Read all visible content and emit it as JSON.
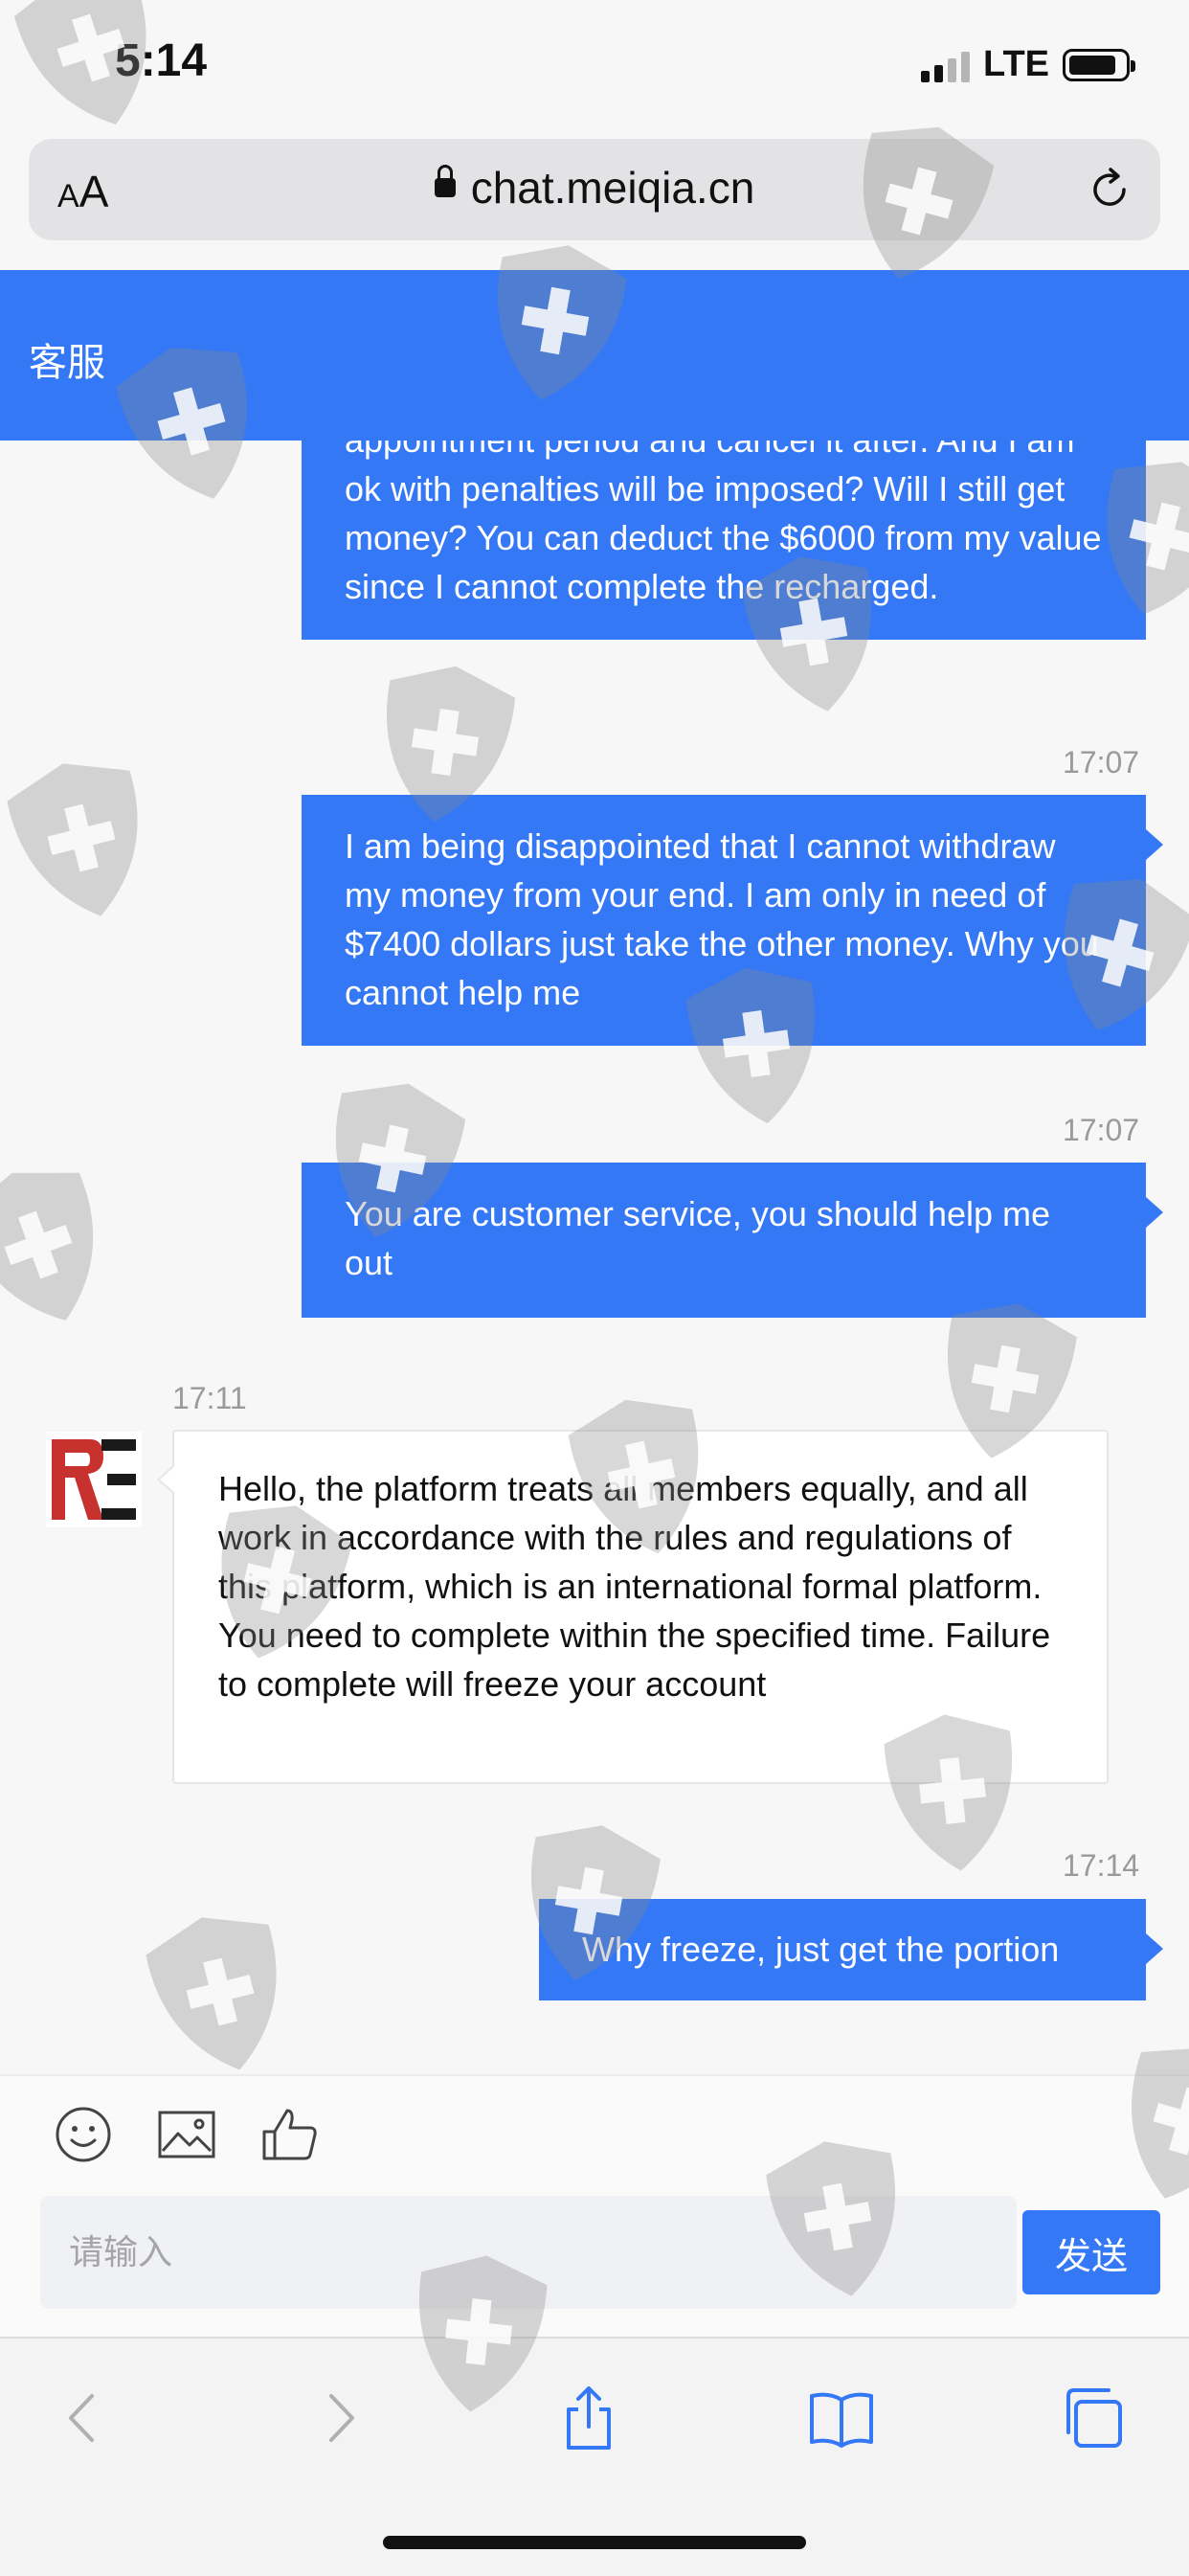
{
  "status_bar": {
    "time": "5:14",
    "network": "LTE"
  },
  "url_bar": {
    "aa_small": "A",
    "aa_large": "A",
    "url": "chat.meiqia.cn"
  },
  "header": {
    "title": "客服"
  },
  "messages": [
    {
      "type": "out",
      "text": "appointment period and cancel it after. And I am ok with penalties will be imposed? Will I still get money? You can deduct the $6000 from my value since I cannot complete the recharged."
    },
    {
      "type": "out",
      "time": "17:07",
      "text": "I am being disappointed that I cannot withdraw my money from your end. I am only in need of $7400 dollars just take the other money. Why you cannot help me"
    },
    {
      "type": "out",
      "time": "17:07",
      "text": "You are customer service, you should help me out"
    },
    {
      "type": "in",
      "time": "17:11",
      "text": "Hello, the platform treats all members equally, and all work in accordance with the rules and regulations of this platform, which is an international formal platform. You need to complete within the specified time. Failure to complete will freeze your account"
    },
    {
      "type": "out",
      "time": "17:14",
      "text": "Why freeze, just get the portion"
    }
  ],
  "input": {
    "placeholder": "请输入",
    "send_label": "发送"
  },
  "colors": {
    "accent": "#3478f6",
    "background": "#f7f7f7"
  }
}
